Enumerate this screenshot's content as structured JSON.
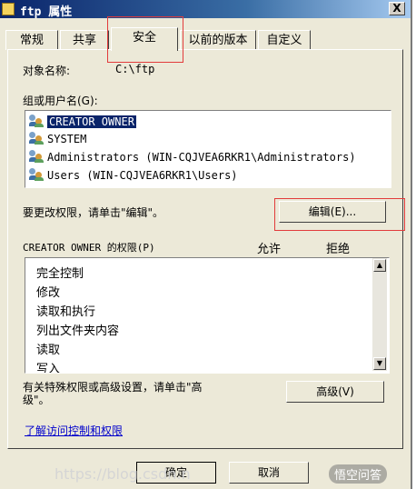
{
  "window": {
    "title": "ftp 属性",
    "close_label": "X"
  },
  "tabs": [
    {
      "label": "常规"
    },
    {
      "label": "共享"
    },
    {
      "label": "安全"
    },
    {
      "label": "以前的版本"
    },
    {
      "label": "自定义"
    }
  ],
  "object": {
    "label": "对象名称:",
    "value": "C:\\ftp"
  },
  "users": {
    "label": "组或用户名(G):",
    "items": [
      {
        "name": "CREATOR OWNER"
      },
      {
        "name": "SYSTEM"
      },
      {
        "name": "Administrators (WIN-CQJVEA6RKR1\\Administrators)"
      },
      {
        "name": "Users (WIN-CQJVEA6RKR1\\Users)"
      }
    ]
  },
  "change": {
    "text": "要更改权限，请单击\"编辑\"。",
    "button": "编辑(E)..."
  },
  "permissions": {
    "header": "CREATOR OWNER 的权限(P)",
    "allow": "允许",
    "deny": "拒绝",
    "items": [
      "完全控制",
      "修改",
      "读取和执行",
      "列出文件夹内容",
      "读取",
      "写入"
    ]
  },
  "advanced": {
    "text_line1": "有关特殊权限或高级设置，请单击\"高",
    "text_line2": "级\"。",
    "button": "高级(V)"
  },
  "link": {
    "text": "了解访问控制和权限"
  },
  "footer": {
    "ok": "确定",
    "cancel": "取消"
  },
  "watermark": {
    "url": "https://blog.csdn.n",
    "badge": "悟空问答"
  }
}
